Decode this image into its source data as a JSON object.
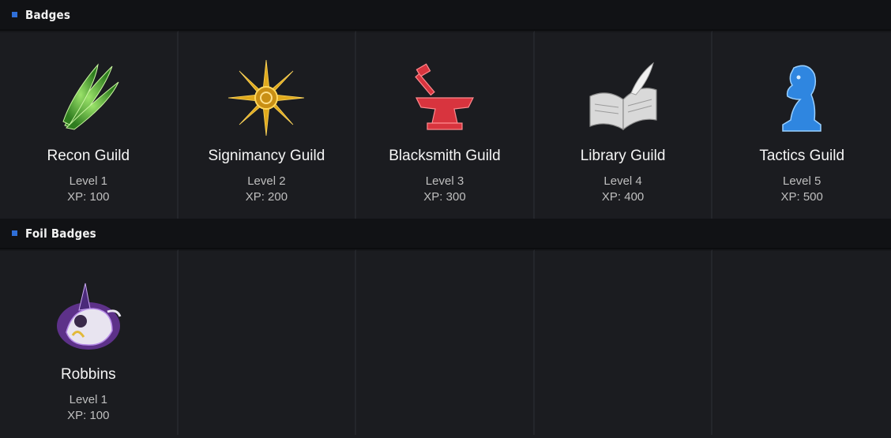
{
  "sections": [
    {
      "title": "Badges",
      "badges": [
        {
          "name": "Recon Guild",
          "level": "Level 1",
          "xp": "XP: 100",
          "icon": "green-wings-icon",
          "color": "#4caf3a"
        },
        {
          "name": "Signimancy Guild",
          "level": "Level 2",
          "xp": "XP: 200",
          "icon": "golden-sun-icon",
          "color": "#e0a91c"
        },
        {
          "name": "Blacksmith Guild",
          "level": "Level 3",
          "xp": "XP: 300",
          "icon": "red-anvil-icon",
          "color": "#d8343e"
        },
        {
          "name": "Library Guild",
          "level": "Level 4",
          "xp": "XP: 400",
          "icon": "open-book-icon",
          "color": "#cfcfcf"
        },
        {
          "name": "Tactics Guild",
          "level": "Level 5",
          "xp": "XP: 500",
          "icon": "blue-knight-icon",
          "color": "#2f86e0"
        }
      ]
    },
    {
      "title": "Foil Badges",
      "badges": [
        {
          "name": "Robbins",
          "level": "Level 1",
          "xp": "XP: 100",
          "icon": "purple-character-icon",
          "color": "#8a3fd1"
        }
      ]
    }
  ]
}
